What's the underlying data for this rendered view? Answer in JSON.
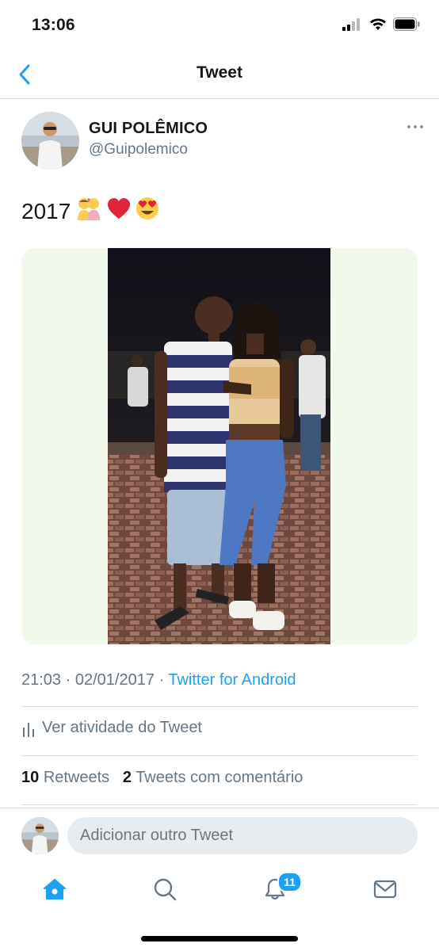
{
  "status_bar": {
    "time": "13:06"
  },
  "nav": {
    "title": "Tweet"
  },
  "author": {
    "name": "GUI POLÊMICO",
    "handle": "@Guipolemico"
  },
  "tweet": {
    "text": "2017",
    "emojis": [
      "couple-kissing-emoji",
      "red-heart-emoji",
      "heart-eyes-emoji"
    ]
  },
  "meta": {
    "time": "21:03",
    "date": "02/01/2017",
    "separator": " · ",
    "source": "Twitter for Android"
  },
  "activity": {
    "label": "Ver atividade do Tweet"
  },
  "stats": {
    "retweets_count": "10",
    "retweets_label": "Retweets",
    "comments_count": "2",
    "comments_label": "Tweets com comentário"
  },
  "reply": {
    "placeholder": "Adicionar outro Tweet"
  },
  "tabbar": {
    "notifications_badge": "11"
  },
  "colors": {
    "accent": "#1da1f2",
    "secondary_text": "#657786",
    "media_bg": "#f1f9ec"
  }
}
